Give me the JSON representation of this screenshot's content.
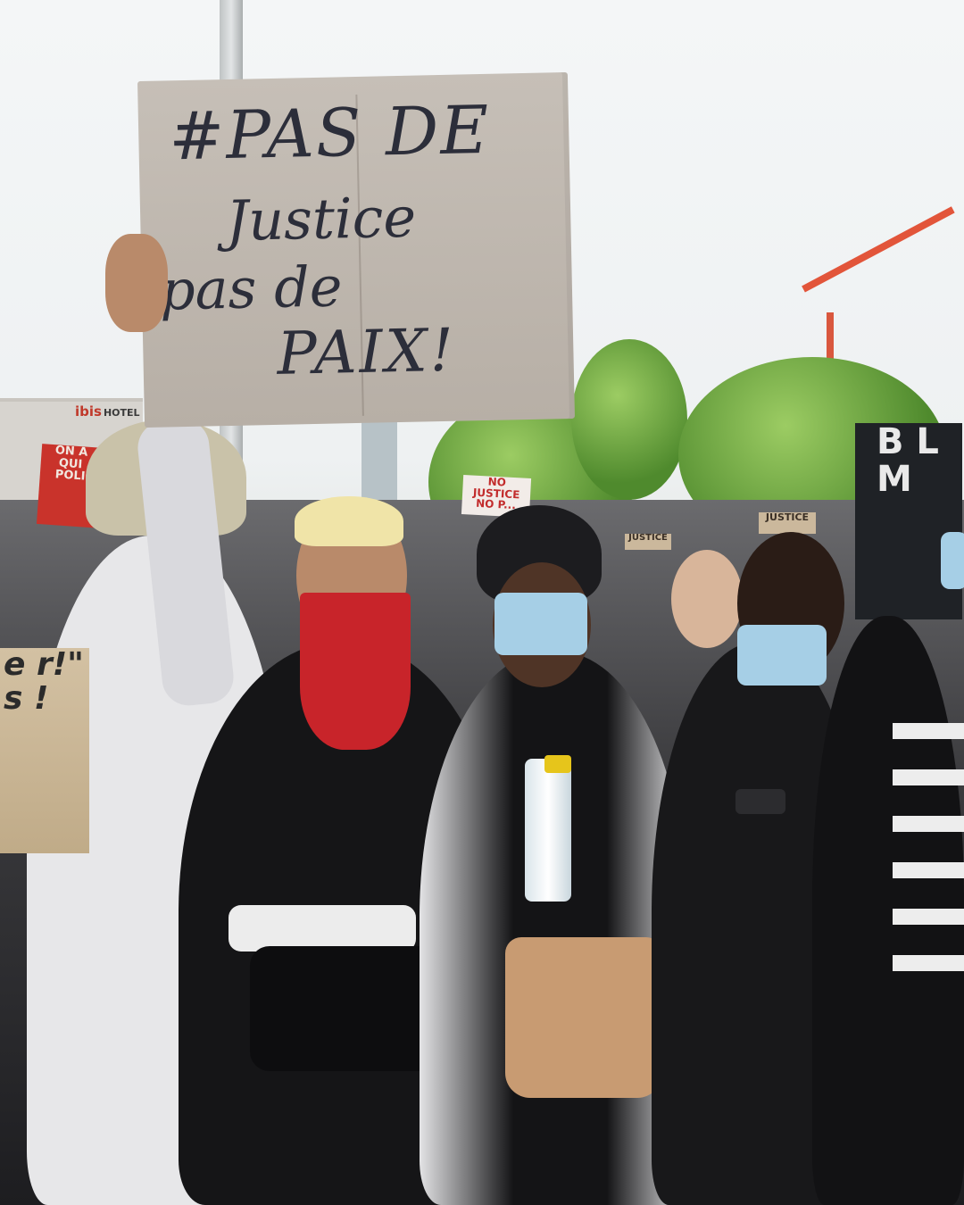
{
  "scene": {
    "description_free": true,
    "colors": {
      "sky": "#f4f6f7",
      "cardboard": "#c6bfb7",
      "ink": "#2c2e3a",
      "bandana": "#c8242a",
      "mask": "#a6cfe6",
      "bag": "#c89b72"
    }
  },
  "main_sign": {
    "line1": "#PAS DE",
    "line2": "Justice",
    "line3": "pas de",
    "line4": "PAIX!"
  },
  "background": {
    "hotel_brand": "ibis",
    "hotel_word": "HOTEL",
    "red_sign_text": "ON A ... QUI ... POLICE",
    "white_sign_text": "NO JUSTICE NO P...",
    "small_sign_text": "JUSTICE",
    "small_sign2_text": "JUSTICE",
    "dark_sign_text": "B L M",
    "left_sign_text": "e r!\" s !"
  }
}
